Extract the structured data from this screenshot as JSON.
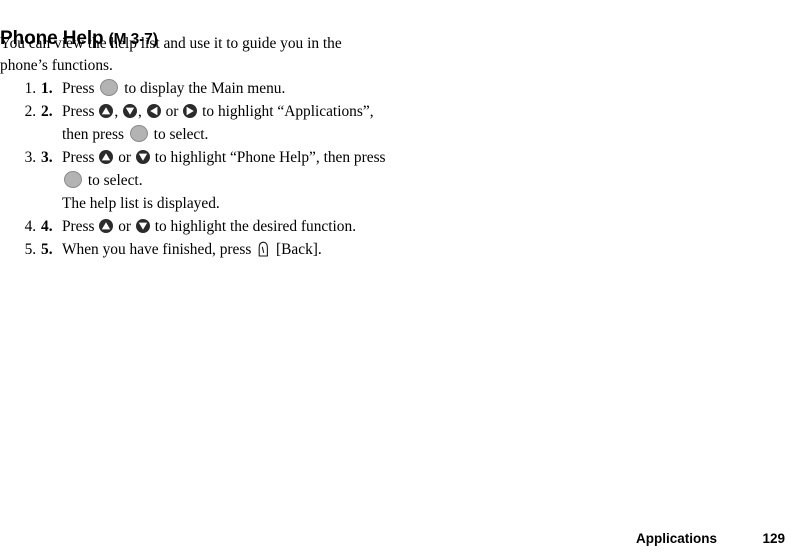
{
  "heading": {
    "title": "Phone Help",
    "menu_code": "(M 3-7)"
  },
  "intro": "You can view the help list and use it to guide you in the phone’s functions.",
  "steps": [
    {
      "number": "1.",
      "lines": [
        {
          "before": "Press ",
          "icon": "center-key",
          "after": " to display the Main menu."
        }
      ]
    },
    {
      "number": "2.",
      "lines": [
        {
          "before": "Press ",
          "icon": "nav-up-key",
          "mid1": ", ",
          "icon2": "nav-down-key",
          "mid2": ", ",
          "icon3": "nav-left-key",
          "mid3": " or ",
          "icon4": "nav-right-key",
          "after": " to highlight “Applications”,"
        },
        {
          "before": "then press ",
          "icon": "center-key",
          "after": " to select."
        }
      ]
    },
    {
      "number": "3.",
      "lines": [
        {
          "before": "Press ",
          "icon": "nav-up-key",
          "mid1": " or ",
          "icon2": "nav-down-key",
          "after": " to highlight “Phone Help”, then press"
        },
        {
          "before": "",
          "icon": "center-key",
          "after": " to select."
        },
        {
          "text": "The help list is displayed."
        }
      ]
    },
    {
      "number": "4.",
      "lines": [
        {
          "before": "Press ",
          "icon": "nav-up-key",
          "mid1": " or ",
          "icon2": "nav-down-key",
          "after": " to highlight the desired function."
        }
      ]
    },
    {
      "number": "5.",
      "lines": [
        {
          "before": "When you have finished, press ",
          "icon": "soft-key",
          "after": " [Back]."
        }
      ]
    }
  ],
  "footer": {
    "section": "Applications",
    "page_number": "129"
  },
  "colors": {
    "text": "#000000",
    "page_background": "#ffffff",
    "center_key_fill": "#b3b3b3",
    "center_key_stroke": "#8a8a8a",
    "nav_key_fill": "#2b2b2b",
    "nav_key_arrow": "#ffffff"
  }
}
